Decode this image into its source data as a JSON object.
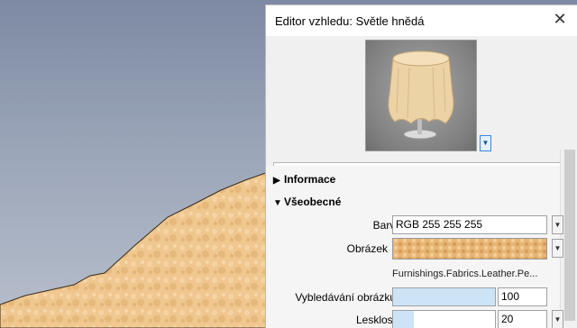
{
  "dialog": {
    "title": "Editor vzhledu: Světle hnědá",
    "close_label": "✕"
  },
  "preview": {
    "dropdown_icon": "chevron-down-icon"
  },
  "sections": {
    "info": {
      "label": "Informace",
      "expanded": false
    },
    "general": {
      "label": "Všeobecné",
      "expanded": true
    }
  },
  "properties": {
    "color": {
      "label": "Barva",
      "value": "RGB 255 255 255"
    },
    "image": {
      "label": "Obrázek",
      "path": "Furnishings.Fabrics.Leather.Pe..."
    },
    "image_fade": {
      "label": "Vybledávání obrázku",
      "value": "100",
      "level": 1.0
    },
    "glossiness": {
      "label": "Lesklost",
      "value": "20",
      "level": 0.2
    }
  },
  "colors": {
    "leather_light": "#f2cf9c",
    "leather_dark": "#d9a468",
    "slider_fill": "#cde4f7",
    "accent": "#3d84d6"
  }
}
